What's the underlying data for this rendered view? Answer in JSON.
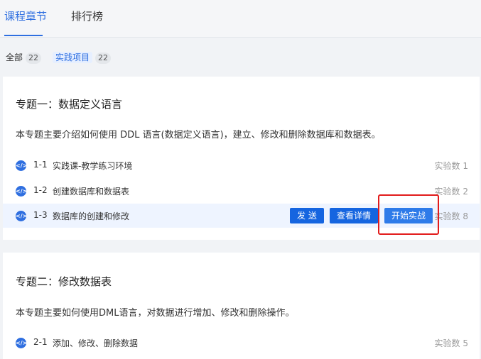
{
  "tabs": {
    "chapters": "课程章节",
    "ranking": "排行榜"
  },
  "filters": {
    "all": {
      "label": "全部",
      "count": "22"
    },
    "practice": {
      "label": "实践项目",
      "count": "22"
    }
  },
  "sections": [
    {
      "title": "专题一：数据定义语言",
      "desc": "本专题主要介绍如何使用 DDL 语言(数据定义语言)，建立、修改和删除数据库和数据表。",
      "items": [
        {
          "num": "1-1",
          "title": "实践课-教学练习环境",
          "count": "实验数 1"
        },
        {
          "num": "1-2",
          "title": "创建数据库和数据表",
          "count": "实验数 2"
        },
        {
          "num": "1-3",
          "title": "数据库的创建和修改",
          "count": "实验数 8"
        }
      ]
    },
    {
      "title": "专题二：修改数据表",
      "desc": "本专题主要如何使用DML语言，对数据进行增加、修改和删除操作。",
      "items": [
        {
          "num": "2-1",
          "title": "添加、修改、删除数据",
          "count": "实验数 5"
        }
      ]
    }
  ],
  "actions": {
    "send": "发 送",
    "details": "查看详情",
    "start": "开始实战"
  },
  "icons": {
    "row_icon": "code-icon"
  },
  "colors": {
    "accent": "#2f6fe0",
    "button": "#1565e0",
    "highlight_box": "#e21b1b"
  }
}
